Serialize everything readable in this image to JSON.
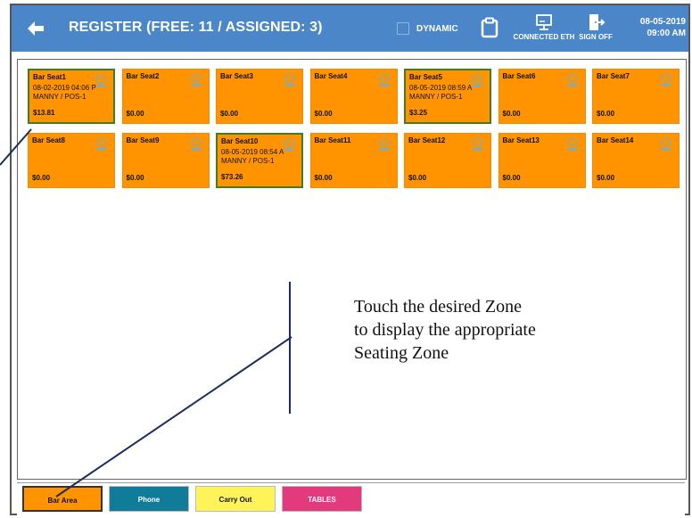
{
  "header": {
    "back_icon": "arrow-left-icon",
    "title": "REGISTER (FREE: 11 / ASSIGNED: 3)",
    "dynamic_label": "DYNAMIC",
    "clipboard_icon": "clipboard-icon",
    "ethernet_label": "CONNECTED ETH",
    "sign_off_label": "SIGN OFF",
    "date": "08-05-2019",
    "time": "09:00 AM",
    "bar_color": "#4a86c8"
  },
  "seats": [
    {
      "name": "Bar Seat1",
      "datetime": "08-02-2019 04:06 P",
      "server": "MANNY / POS-1",
      "amount": "$13.81",
      "assigned": true
    },
    {
      "name": "Bar Seat2",
      "datetime": "",
      "server": "",
      "amount": "$0.00",
      "assigned": false
    },
    {
      "name": "Bar Seat3",
      "datetime": "",
      "server": "",
      "amount": "$0.00",
      "assigned": false
    },
    {
      "name": "Bar Seat4",
      "datetime": "",
      "server": "",
      "amount": "$0.00",
      "assigned": false
    },
    {
      "name": "Bar Seat5",
      "datetime": "08-05-2019 08:59 A",
      "server": "MANNY / POS-1",
      "amount": "$3.25",
      "assigned": true
    },
    {
      "name": "Bar Seat6",
      "datetime": "",
      "server": "",
      "amount": "$0.00",
      "assigned": false
    },
    {
      "name": "Bar Seat7",
      "datetime": "",
      "server": "",
      "amount": "$0.00",
      "assigned": false
    },
    {
      "name": "Bar Seat8",
      "datetime": "",
      "server": "",
      "amount": "$0.00",
      "assigned": false
    },
    {
      "name": "Bar Seat9",
      "datetime": "",
      "server": "",
      "amount": "$0.00",
      "assigned": false
    },
    {
      "name": "Bar Seat10",
      "datetime": "08-05-2019 08:54 A",
      "server": "MANNY / POS-1",
      "amount": "$73.26",
      "assigned": true
    },
    {
      "name": "Bar Seat11",
      "datetime": "",
      "server": "",
      "amount": "$0.00",
      "assigned": false
    },
    {
      "name": "Bar Seat12",
      "datetime": "",
      "server": "",
      "amount": "$0.00",
      "assigned": false
    },
    {
      "name": "Bar Seat13",
      "datetime": "",
      "server": "",
      "amount": "$0.00",
      "assigned": false
    },
    {
      "name": "Bar Seat14",
      "datetime": "",
      "server": "",
      "amount": "$0.00",
      "assigned": false
    }
  ],
  "zones": [
    {
      "label": "Bar Area",
      "color": "#ff9400",
      "text_color": "#111111",
      "selected": true
    },
    {
      "label": "Phone",
      "color": "#117c99",
      "text_color": "#ffffff",
      "selected": false
    },
    {
      "label": "Carry Out",
      "color": "#fff35a",
      "text_color": "#111111",
      "selected": false
    },
    {
      "label": "TABLES",
      "color": "#e23a7c",
      "text_color": "#ffffff",
      "selected": false
    }
  ],
  "annotation": {
    "line1": "Touch the desired Zone",
    "line2": "to display the appropriate",
    "line3": "Seating Zone"
  },
  "colors": {
    "seat_free": "#ff9400",
    "seat_assigned_border": "#3f7f23",
    "callout_line": "#1b2d5c"
  }
}
